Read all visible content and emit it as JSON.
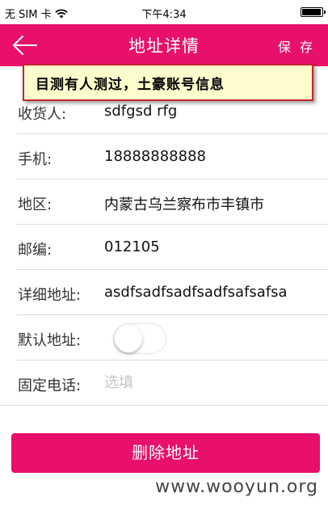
{
  "status_bar": {
    "carrier": "无 SIM 卡",
    "time": "下午4:34",
    "battery_level": 0.95
  },
  "header": {
    "title": "地址详情",
    "save_label": "保 存",
    "back_icon": "arrow-left-icon"
  },
  "annotation": "目测有人测过，土豪账号信息",
  "form": {
    "receiver": {
      "label": "收货人:",
      "value": "sdfgsd rfg"
    },
    "phone": {
      "label": "手机:",
      "value": "18888888888"
    },
    "region": {
      "label": "地区:",
      "value": "内蒙古乌兰察布市丰镇市"
    },
    "postcode": {
      "label": "邮编:",
      "value": "012105"
    },
    "address": {
      "label": "详细地址:",
      "value": "asdfsadfsadfsadfsafsafsa"
    },
    "default": {
      "label": "默认地址:",
      "on": false
    },
    "landline": {
      "label": "固定电话:",
      "value": "",
      "placeholder": "选填"
    }
  },
  "delete_label": "删除地址",
  "watermark": "www.wooyun.org",
  "colors": {
    "accent": "#e8106a",
    "annotation_bg": "#fefccc",
    "annotation_border": "#c0282b"
  }
}
